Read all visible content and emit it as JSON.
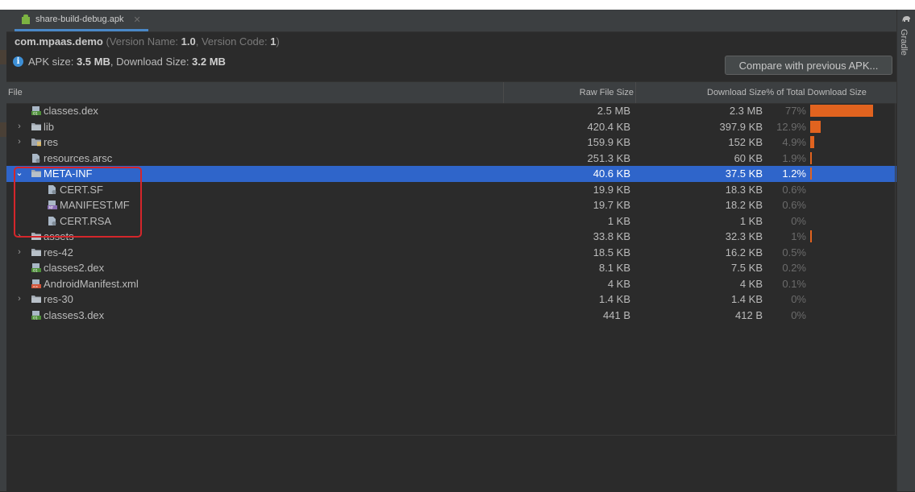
{
  "tab": {
    "label": "share-build-debug.apk"
  },
  "package": {
    "name": "com.mpaas.demo",
    "version_name_label": "(Version Name: ",
    "version_name": "1.0",
    "version_code_label": ", Version Code: ",
    "version_code": "1",
    "close_paren": ")"
  },
  "apk_info": {
    "apk_size_label": "APK size: ",
    "apk_size": "3.5 MB",
    "download_size_label": ", Download Size: ",
    "download_size": "3.2 MB"
  },
  "compare_button": "Compare with previous APK...",
  "columns": {
    "file": "File",
    "raw": "Raw File Size",
    "download": "Download Size% of Total Download Size"
  },
  "rows": [
    {
      "name": "classes.dex",
      "raw": "2.5 MB",
      "dl": "2.3 MB",
      "pct": "77%",
      "share": 0.77,
      "level": 0,
      "expand": "none",
      "icon": "dex-file-icon"
    },
    {
      "name": "lib",
      "raw": "420.4 KB",
      "dl": "397.9 KB",
      "pct": "12.9%",
      "share": 0.129,
      "level": 0,
      "expand": "collapsed",
      "icon": "folder-icon"
    },
    {
      "name": "res",
      "raw": "159.9 KB",
      "dl": "152 KB",
      "pct": "4.9%",
      "share": 0.049,
      "level": 0,
      "expand": "collapsed",
      "icon": "resource-folder-icon"
    },
    {
      "name": "resources.arsc",
      "raw": "251.3 KB",
      "dl": "60 KB",
      "pct": "1.9%",
      "share": 0.019,
      "level": 0,
      "expand": "none",
      "icon": "generic-file-icon"
    },
    {
      "name": "META-INF",
      "raw": "40.6 KB",
      "dl": "37.5 KB",
      "pct": "1.2%",
      "share": 0.012,
      "level": 0,
      "expand": "expanded",
      "icon": "folder-icon",
      "selected": true
    },
    {
      "name": "CERT.SF",
      "raw": "19.9 KB",
      "dl": "18.3 KB",
      "pct": "0.6%",
      "share": 0,
      "level": 1,
      "expand": "none",
      "icon": "generic-file-icon"
    },
    {
      "name": "MANIFEST.MF",
      "raw": "19.7 KB",
      "dl": "18.2 KB",
      "pct": "0.6%",
      "share": 0,
      "level": 1,
      "expand": "none",
      "icon": "manifest-file-icon"
    },
    {
      "name": "CERT.RSA",
      "raw": "1 KB",
      "dl": "1 KB",
      "pct": "0%",
      "share": 0,
      "level": 1,
      "expand": "none",
      "icon": "generic-file-icon"
    },
    {
      "name": "assets",
      "raw": "33.8 KB",
      "dl": "32.3 KB",
      "pct": "1%",
      "share": 0.01,
      "level": 0,
      "expand": "collapsed",
      "icon": "folder-icon"
    },
    {
      "name": "res-42",
      "raw": "18.5 KB",
      "dl": "16.2 KB",
      "pct": "0.5%",
      "share": 0,
      "level": 0,
      "expand": "collapsed",
      "icon": "folder-icon"
    },
    {
      "name": "classes2.dex",
      "raw": "8.1 KB",
      "dl": "7.5 KB",
      "pct": "0.2%",
      "share": 0,
      "level": 0,
      "expand": "none",
      "icon": "dex-file-icon"
    },
    {
      "name": "AndroidManifest.xml",
      "raw": "4 KB",
      "dl": "4 KB",
      "pct": "0.1%",
      "share": 0,
      "level": 0,
      "expand": "none",
      "icon": "xml-file-icon"
    },
    {
      "name": "res-30",
      "raw": "1.4 KB",
      "dl": "1.4 KB",
      "pct": "0%",
      "share": 0,
      "level": 0,
      "expand": "collapsed",
      "icon": "folder-icon"
    },
    {
      "name": "classes3.dex",
      "raw": "441 B",
      "dl": "412 B",
      "pct": "0%",
      "share": 0,
      "level": 0,
      "expand": "none",
      "icon": "dex-file-icon"
    }
  ],
  "right_panel": {
    "label": "Gradle"
  },
  "colors": {
    "selection": "#2f65ca",
    "bar": "#e1631f",
    "highlight_box": "#d4262b",
    "info": "#3d8fd6"
  }
}
